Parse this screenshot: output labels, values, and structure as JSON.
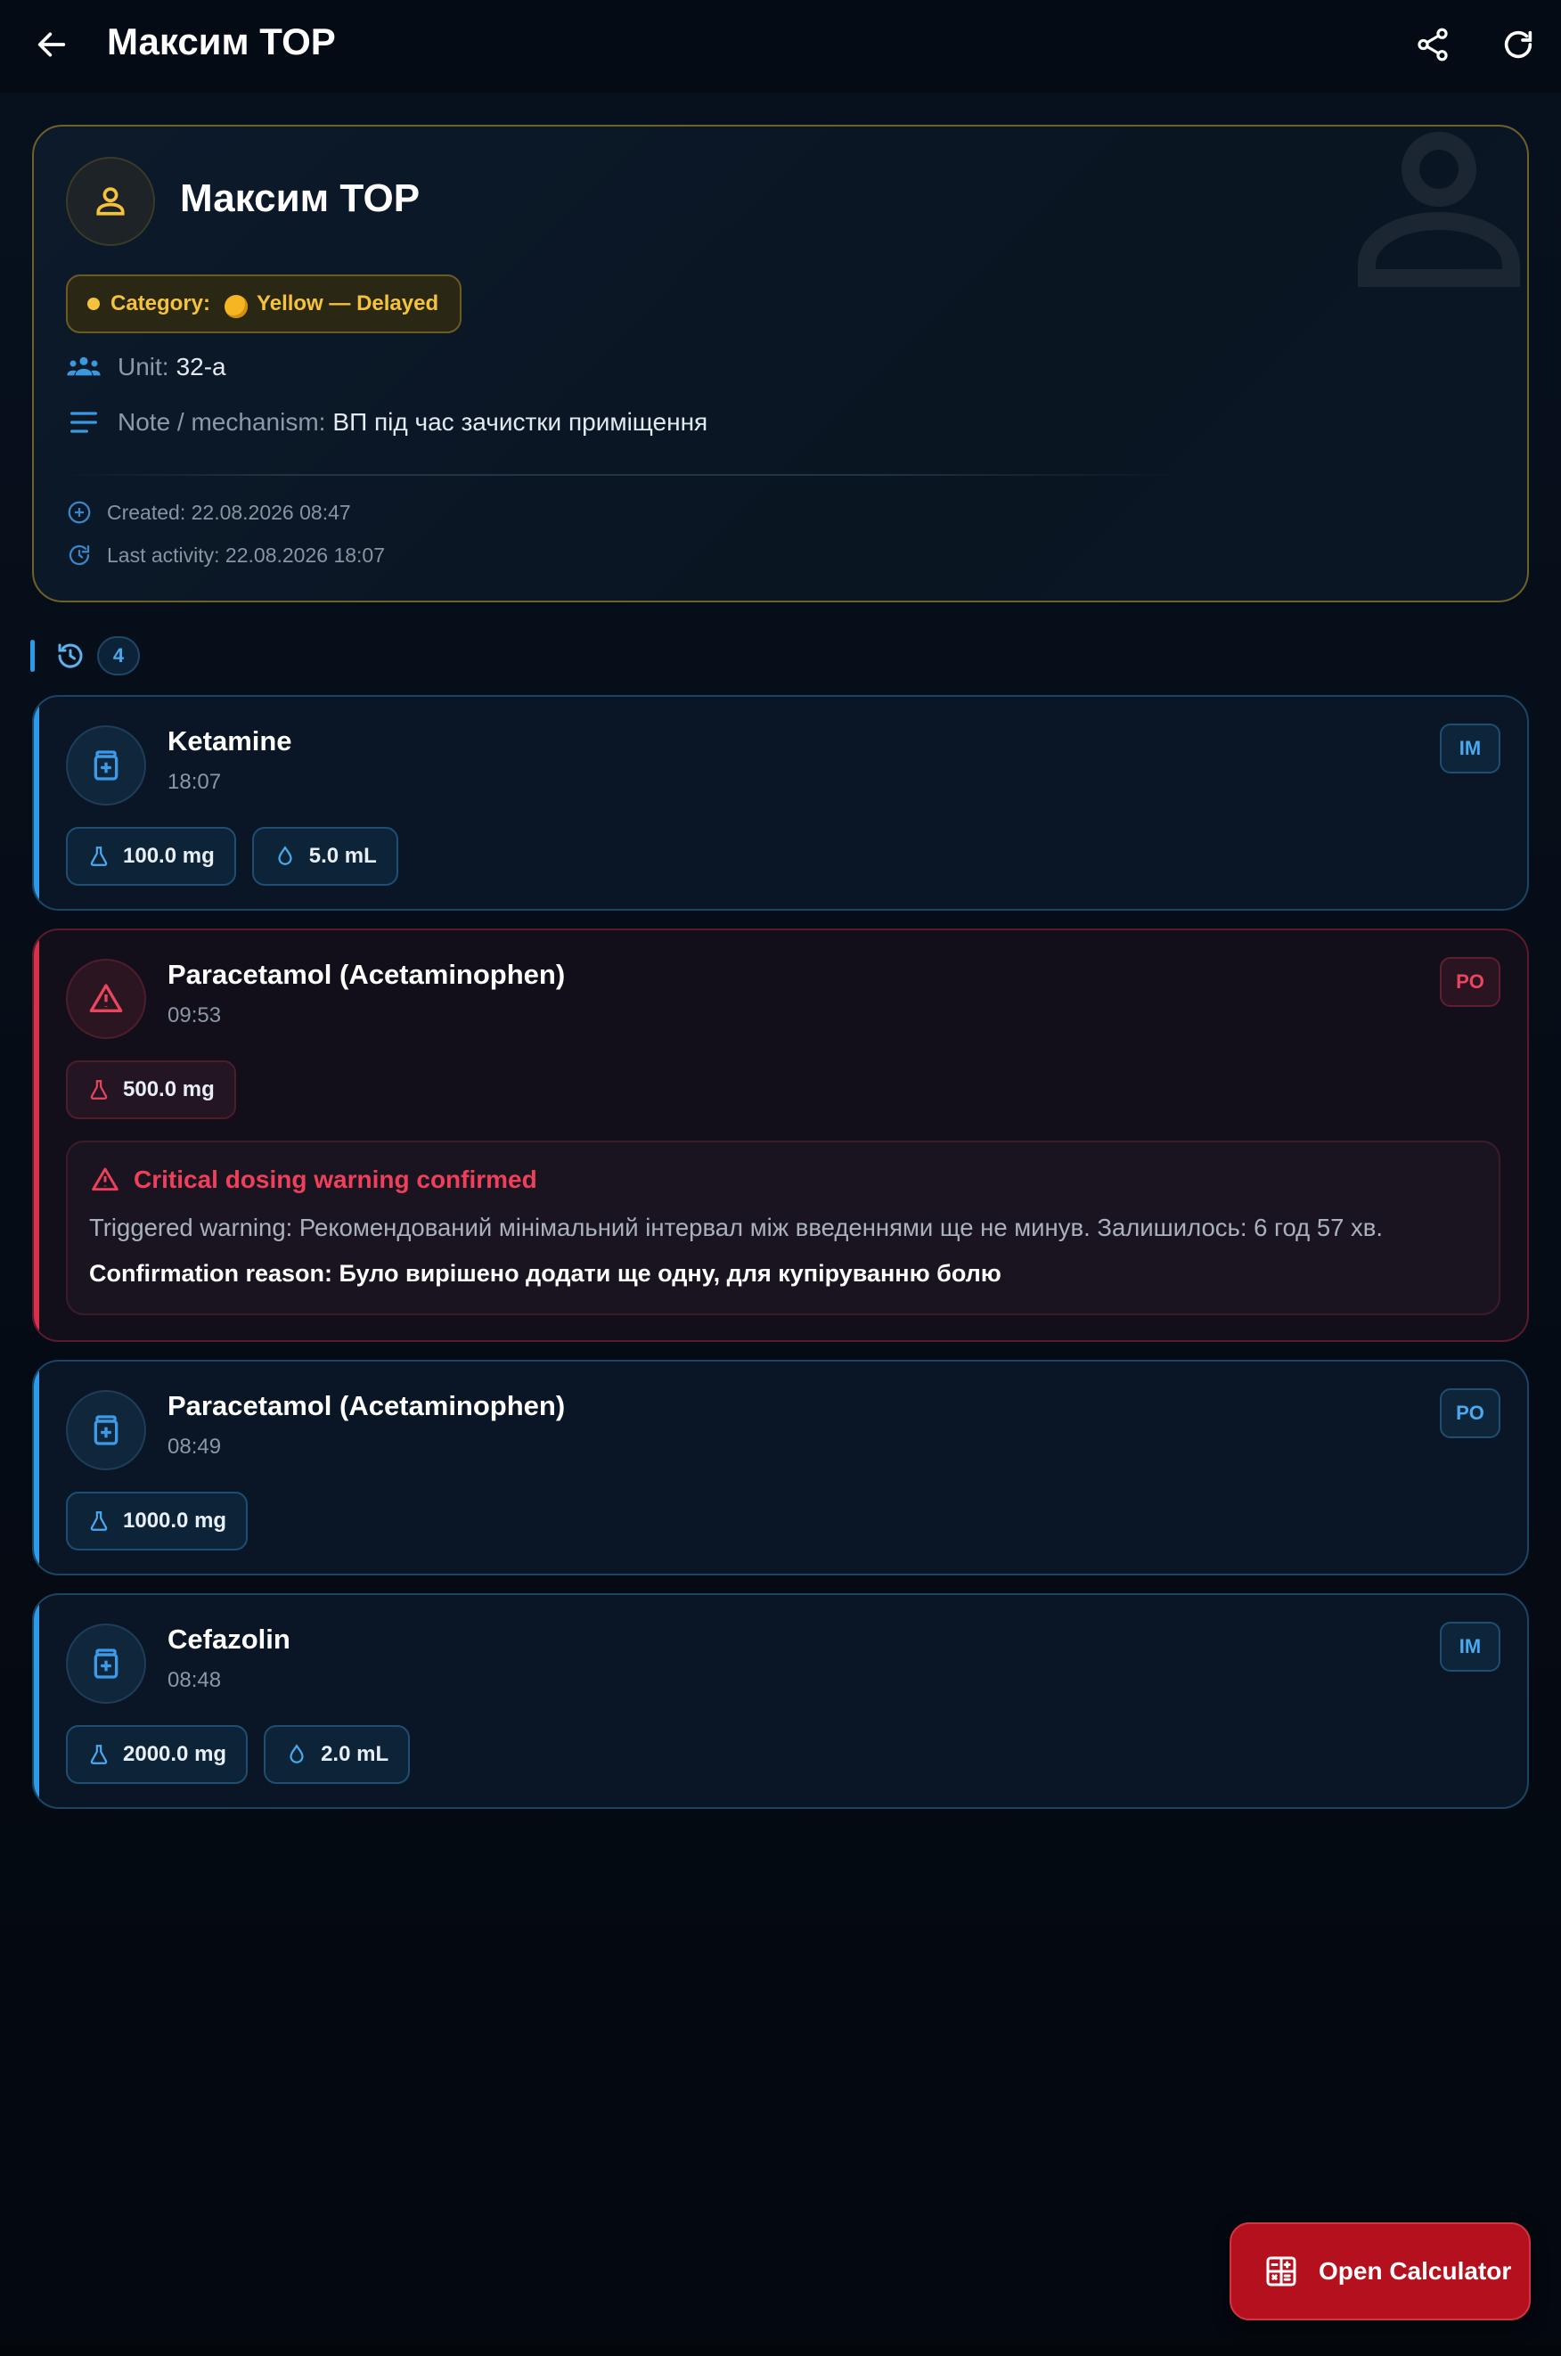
{
  "appbar": {
    "title": "Максим TOP",
    "icons": [
      "arrow-left-icon",
      "share-icon",
      "refresh-icon"
    ]
  },
  "patient": {
    "name": "Максим TOP",
    "category_label": "Category:",
    "category_value": "Yellow — Delayed",
    "category_color": "#f4c23c",
    "unit_label": "Unit:",
    "unit_value": "32-а",
    "note_label": "Note / mechanism:",
    "note_value": "ВП під час зачистки приміщення",
    "created": "Created: 22.08.2026 08:47",
    "last_activity": "Last activity: 22.08.2026 18:07"
  },
  "history": {
    "count": "4"
  },
  "medications": [
    {
      "name": "Ketamine",
      "time": "18:07",
      "route": "IM",
      "dose": "100.0 mg",
      "volume": "5.0 mL"
    },
    {
      "name": "Paracetamol (Acetaminophen)",
      "time": "09:53",
      "route": "PO",
      "dose": "500.0 mg",
      "warning": {
        "title": "Critical dosing warning confirmed",
        "text": "Triggered warning: Рекомендований мінімальний інтервал між введеннями ще не минув. Залишилось: 6 год 57 хв.",
        "reason_label": "Confirmation reason:",
        "reason_value": "Було вирішено додати ще одну, для купіруванню болю"
      }
    },
    {
      "name": "Paracetamol (Acetaminophen)",
      "time": "08:49",
      "route": "PO",
      "dose": "1000.0 mg"
    },
    {
      "name": "Cefazolin",
      "time": "08:48",
      "route": "IM",
      "dose": "2000.0 mg",
      "volume": "2.0 mL"
    }
  ],
  "fab": {
    "label": "Open Calculator"
  },
  "colors": {
    "accent_blue": "#2c9cea",
    "warning_red": "#d7304b",
    "category_yellow": "#f4c23c",
    "fab_red": "#b4101e"
  }
}
